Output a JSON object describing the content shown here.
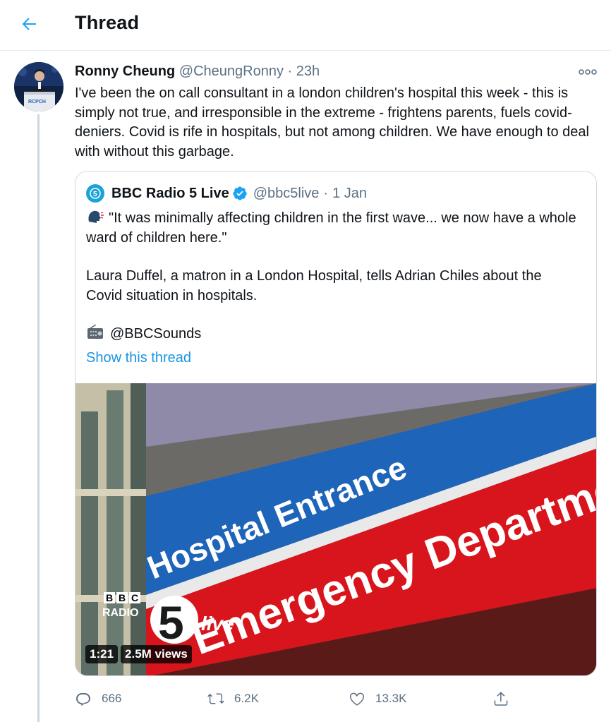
{
  "header": {
    "title": "Thread"
  },
  "tweet": {
    "author_name": "Ronny Cheung",
    "author_handle": "@CheungRonny",
    "separator": "·",
    "time": "23h",
    "text": "I've been the on call consultant in a london children's hospital this week - this is simply not true, and irresponsible in the extreme - frightens parents, fuels covid-deniers. Covid is rife in hospitals, but not among children. We have enough to deal with without this garbage.",
    "avatar_logo_text": "RCPCH"
  },
  "quote": {
    "author_name": "BBC Radio 5 Live",
    "author_handle": "@bbc5live",
    "separator": "·",
    "time": "1 Jan",
    "line1": "\"It was minimally affecting children in the first wave... we now have a whole ward of children here.\"",
    "line2": "Laura Duffel, a matron in a London Hospital, tells Adrian Chiles about the Covid situation in hospitals.",
    "line3": "@BBCSounds",
    "show_thread": "Show this thread",
    "media": {
      "sign_top": "Hospital Entrance",
      "sign_bottom": "Emergency Department",
      "logo_bbc": [
        "B",
        "B",
        "C"
      ],
      "logo_radio": "RADIO",
      "logo_five": "5",
      "logo_live": "live",
      "duration": "1:21",
      "views": "2.5M views"
    }
  },
  "actions": {
    "replies": "666",
    "retweets": "6.2K",
    "likes": "13.3K"
  },
  "colors": {
    "accent": "#1da1f2",
    "link": "#1b95e0",
    "muted": "#5b7083",
    "sign_blue": "#1e64b8",
    "sign_red": "#d8141c"
  }
}
